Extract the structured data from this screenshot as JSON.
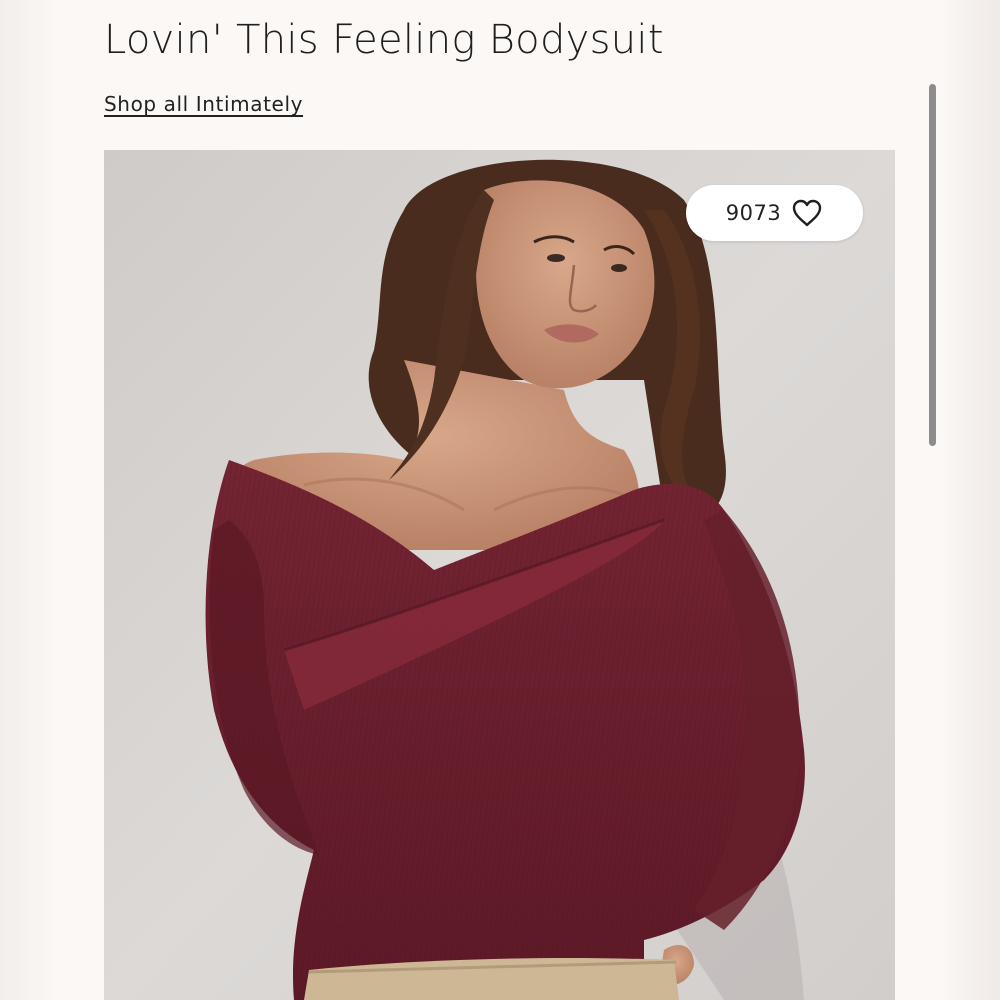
{
  "product": {
    "title": "Lovin' This Feeling Bodysuit",
    "shop_link": "Shop all Intimately"
  },
  "favorites": {
    "count": "9073",
    "icon": "heart-outline-icon"
  },
  "image": {
    "description_colors": {
      "background": "#d9d6d4",
      "garment": "#6b1e2b",
      "skin": "#c99578",
      "hair": "#4a2c1e",
      "pants": "#cdb795"
    }
  },
  "colors": {
    "page_background": "#fbf8f6",
    "text": "#1f1f1f",
    "scrollbar": "#8d8b8b"
  }
}
